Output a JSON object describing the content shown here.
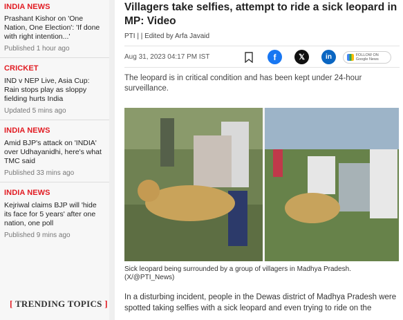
{
  "sidebar": {
    "items": [
      {
        "category": "INDIA NEWS",
        "title": "Prashant Kishor on 'One Nation, One Election': 'If done with right intention...'",
        "time": "Published 1 hour ago"
      },
      {
        "category": "CRICKET",
        "title": "IND v NEP Live, Asia Cup: Rain stops play as sloppy fielding hurts India",
        "time": "Updated 5 mins ago"
      },
      {
        "category": "INDIA NEWS",
        "title": "Amid BJP's attack on 'INDIA' over Udhayanidhi, here's what TMC said",
        "time": "Published 33 mins ago"
      },
      {
        "category": "INDIA NEWS",
        "title": "Kejriwal claims BJP will 'hide its face for 5 years' after one nation, one poll",
        "time": "Published 9 mins ago"
      }
    ],
    "trending_label": "TRENDING TOPICS"
  },
  "article": {
    "headline": "Villagers take selfies, attempt to ride a sick leopard in MP: Video",
    "byline": "PTI | | Edited by Arfa Javaid",
    "date": "Aug 31, 2023 04:17 PM IST",
    "share_icons": [
      "bookmark-icon",
      "facebook-icon",
      "x-icon",
      "linkedin-icon"
    ],
    "google_news_label": "FOLLOW ON Google News",
    "lede": "The leopard is in critical condition and has been kept under 24-hour surveillance.",
    "caption": "Sick leopard being surrounded by a group of villagers in Madhya Pradesh. (X/@PTI_News)",
    "body": "In a disturbing incident, people in the Dewas district of Madhya Pradesh were spotted taking selfies with a sick leopard and even trying to ride on the"
  },
  "colors": {
    "accent": "#e21b22",
    "facebook": "#1877f2",
    "linkedin": "#0a66c2"
  }
}
